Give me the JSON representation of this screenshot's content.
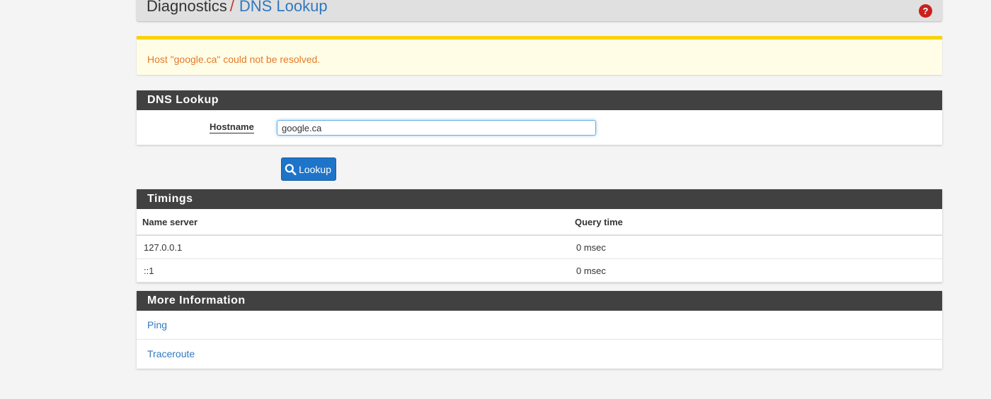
{
  "breadcrumb": {
    "section": "Diagnostics",
    "separator": "/",
    "current": "DNS Lookup",
    "help_glyph": "?"
  },
  "icons": {
    "help": "question-circle-icon",
    "lookup": "search-icon"
  },
  "alert": {
    "message": "Host \"google.ca\" could not be resolved."
  },
  "lookup_panel": {
    "title": "DNS Lookup",
    "hostname_label": "Hostname",
    "hostname_value": "google.ca"
  },
  "lookup_button": {
    "label": "Lookup"
  },
  "timings": {
    "title": "Timings",
    "columns": [
      "Name server",
      "Query time"
    ],
    "rows": [
      [
        "127.0.0.1",
        "0 msec"
      ],
      [
        "::1",
        "0 msec"
      ]
    ]
  },
  "more_info": {
    "title": "More Information",
    "links": [
      "Ping",
      "Traceroute"
    ]
  },
  "colors": {
    "panel_heading": "#414141",
    "link": "#3079c0",
    "alert_border": "#f9d300",
    "alert_text": "#e5792a",
    "button": "#1e74c8"
  }
}
